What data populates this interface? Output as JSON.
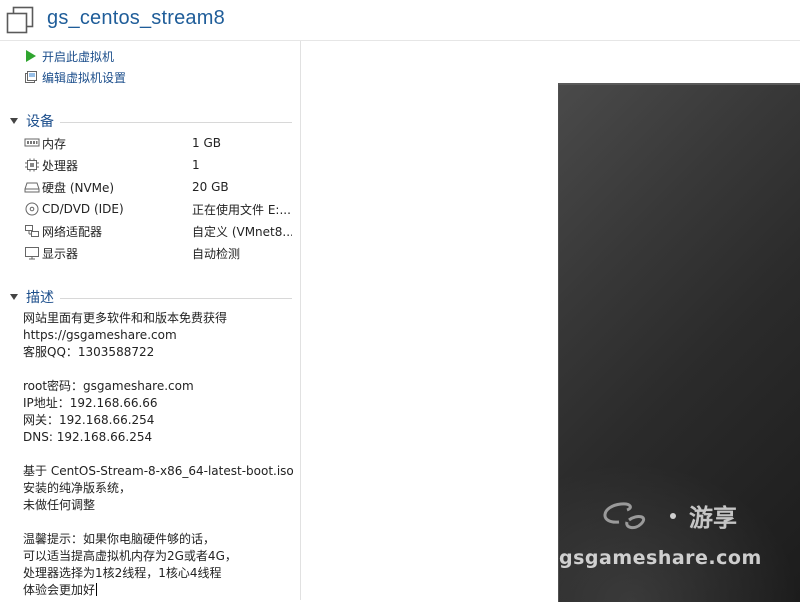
{
  "window": {
    "title": "gs_centos_stream8",
    "icon": "vm-window-icon"
  },
  "actions": [
    {
      "label": "开启此虚拟机",
      "icon": "play-icon"
    },
    {
      "label": "编辑虚拟机设置",
      "icon": "edit-settings-icon"
    }
  ],
  "devices": {
    "title": "设备",
    "items": [
      {
        "name": "内存",
        "value": "1 GB",
        "icon": "memory-icon"
      },
      {
        "name": "处理器",
        "value": "1",
        "icon": "cpu-icon"
      },
      {
        "name": "硬盘 (NVMe)",
        "value": "20 GB",
        "icon": "hard-disk-icon"
      },
      {
        "name": "CD/DVD (IDE)",
        "value": "正在使用文件 E:...",
        "icon": "cd-dvd-icon"
      },
      {
        "name": "网络适配器",
        "value": "自定义 (VMnet8...",
        "icon": "network-adapter-icon"
      },
      {
        "name": "显示器",
        "value": "自动检测",
        "icon": "display-icon"
      }
    ]
  },
  "description": {
    "title": "描述",
    "text": "网站里面有更多软件和和版本免费获得\nhttps://gsgameshare.com\n客服QQ：1303588722\n\nroot密码：gsgameshare.com\nIP地址：192.168.66.66\n网关：192.168.66.254\nDNS: 192.168.66.254\n\n基于 CentOS-Stream-8-x86_64-latest-boot.iso\n安装的纯净版系统，\n未做任何调整\n\n温馨提示：如果你电脑硬件够的话，\n可以适当提高虚拟机内存为2G或者4G，\n处理器选择为1核2线程，1核心4线程\n体验会更加好"
  },
  "preview": {
    "watermark_logo_text": "GS·游享",
    "watermark_site": "gsgameshare.com"
  },
  "colors": {
    "title": "#1f5d99",
    "link": "#1d4f8c",
    "play_green": "#2fa52f"
  }
}
